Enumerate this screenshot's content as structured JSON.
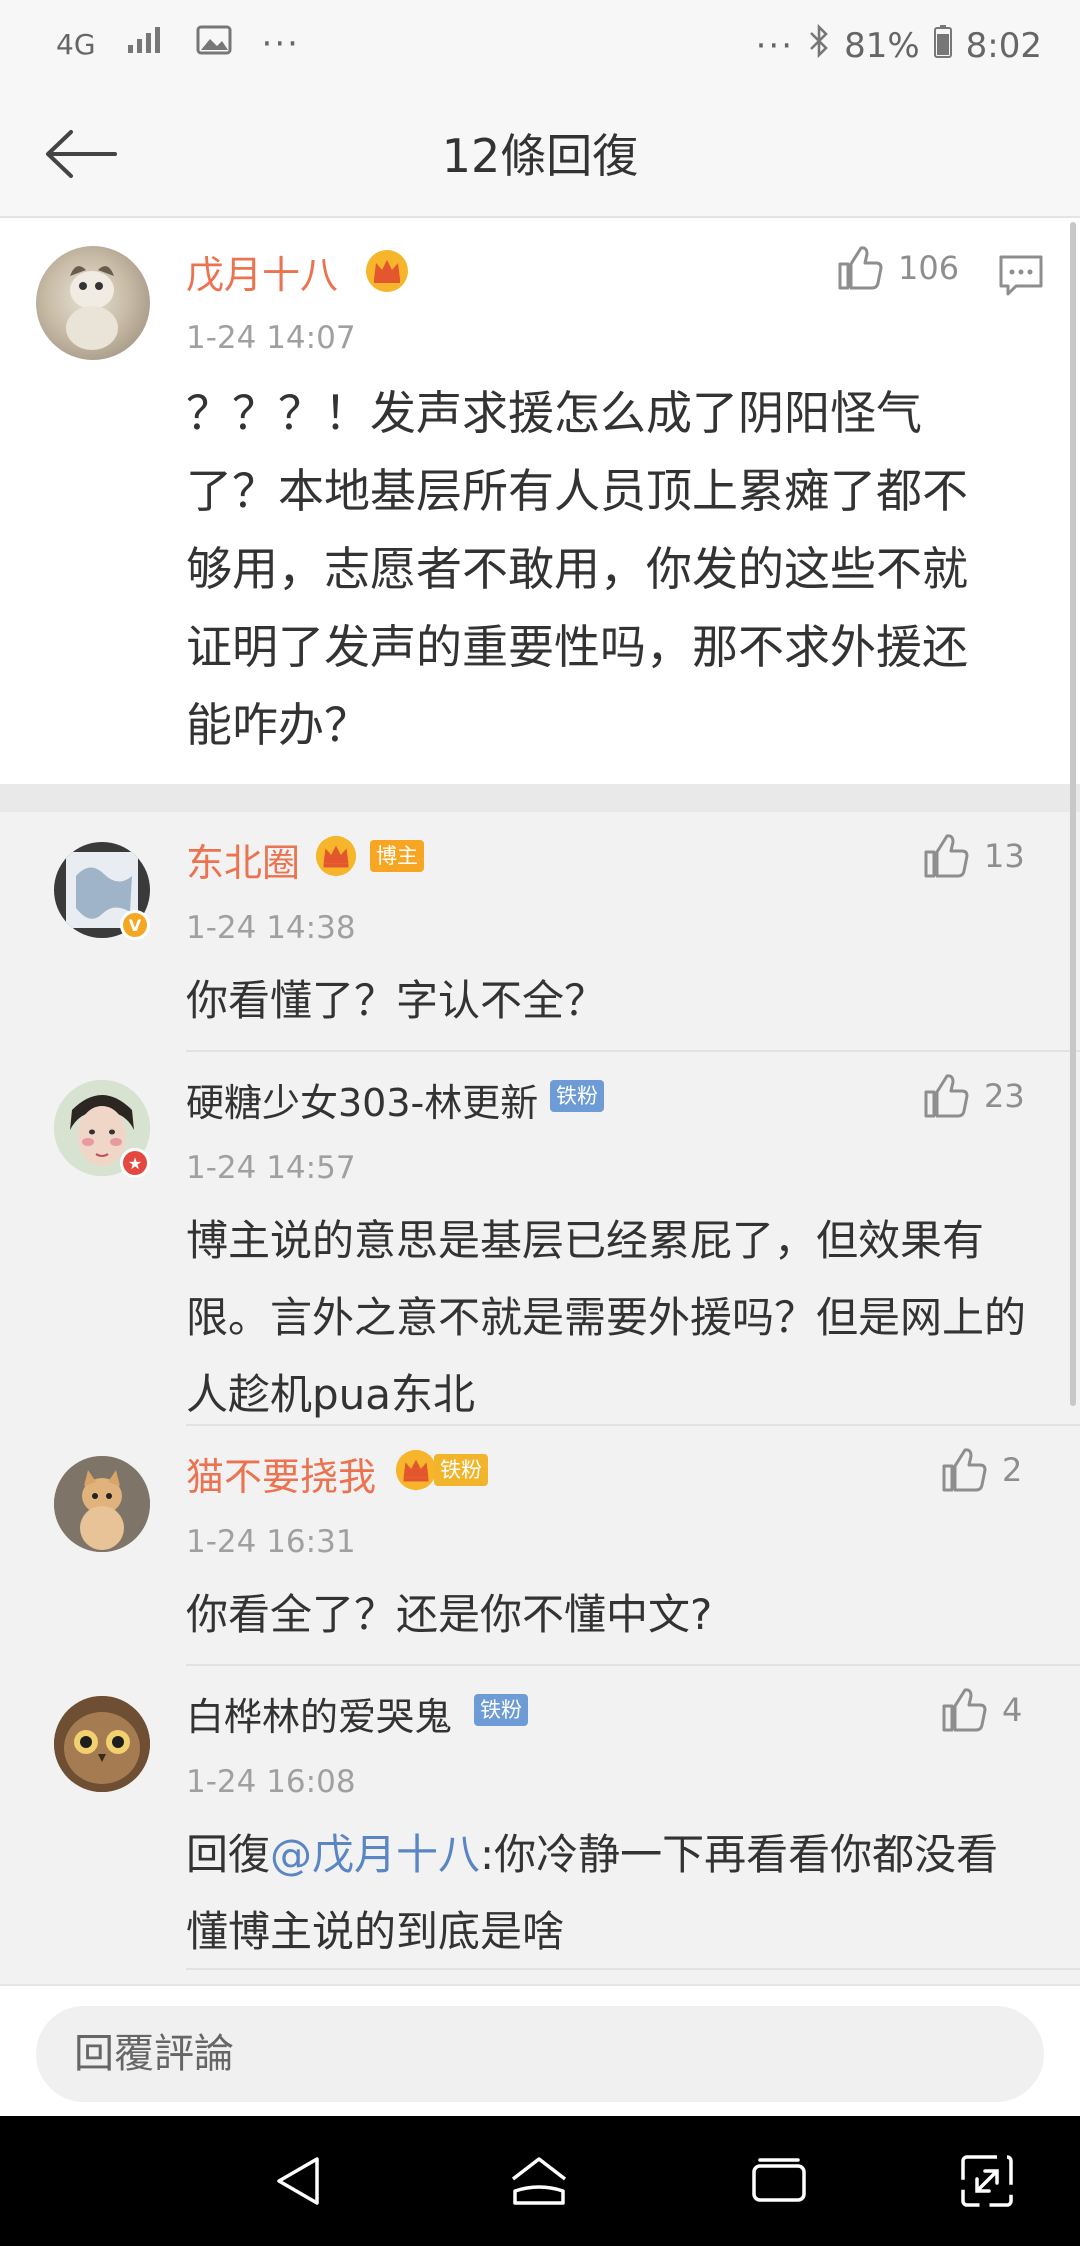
{
  "status_bar": {
    "network": "4G",
    "battery": "81%",
    "time": "8:02",
    "icons": [
      "signal-icon",
      "image-icon",
      "more-dots-icon",
      "bluetooth-icon",
      "battery-icon"
    ]
  },
  "header": {
    "title": "12條回復",
    "back_icon": "back-arrow-icon"
  },
  "original_comment": {
    "username": "戊月十八",
    "time": "1-24 14:07",
    "likes": "106",
    "text_lines": [
      "？？？！发声求援怎么成了阴阳怪气",
      "了？本地基层所有人员顶上累瘫了都不",
      "够用，志愿者不敢用，你发的这些不就",
      "证明了发声的重要性吗，那不求外援还",
      "能咋办？"
    ]
  },
  "replies": [
    {
      "username": "东北圈",
      "badge": "博主",
      "time": "1-24 14:38",
      "likes": "13",
      "text_lines": [
        "你看懂了？字认不全？"
      ]
    },
    {
      "username": "硬糖少女303-林更新",
      "badge": "铁粉",
      "time": "1-24 14:57",
      "likes": "23",
      "text_lines": [
        "博主说的意思是基层已经累屁了，但效果有",
        "限。言外之意不就是需要外援吗？但是网上的",
        "人趁机pua东北"
      ]
    },
    {
      "username": "猫不要挠我",
      "badge": "铁粉",
      "time": "1-24 16:31",
      "likes": "2",
      "text_lines": [
        "你看全了？还是你不懂中文?"
      ]
    },
    {
      "username": "白桦林的爱哭鬼",
      "badge": "铁粉",
      "time": "1-24 16:08",
      "likes": "4",
      "reply_prefix": "回復",
      "mention": "@戊月十八",
      "text_after_mention": ":你冷静一下再看看你都没看",
      "text_line2": "懂博主说的到底是啥"
    }
  ],
  "reply_bar": {
    "placeholder": "回覆評論"
  },
  "colors": {
    "accent_orange": "#eb7350",
    "mention_blue": "#5a86c4",
    "badge_orange": "#f6a623",
    "badge_blue": "#6d9bd6"
  }
}
